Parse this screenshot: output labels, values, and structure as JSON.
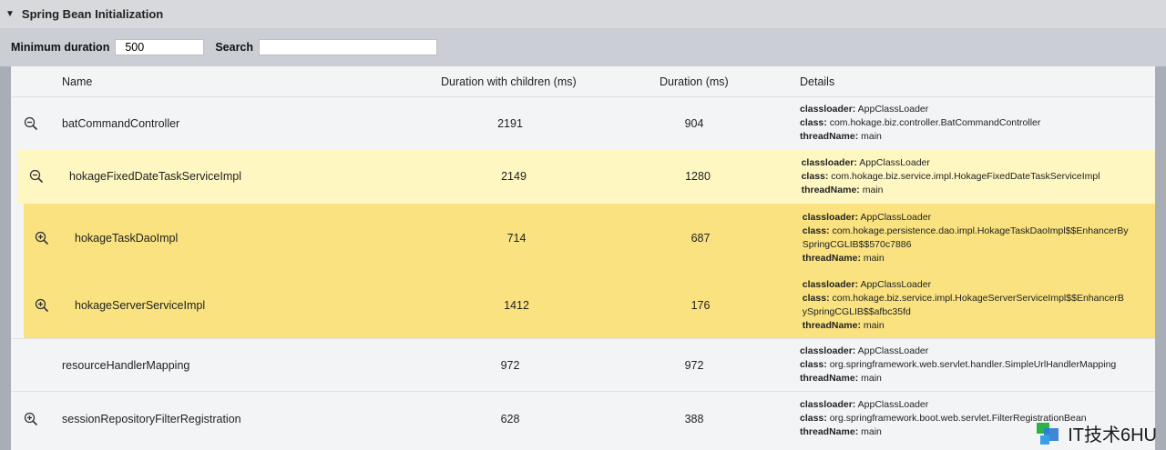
{
  "header": {
    "title": "Spring Bean Initialization"
  },
  "controls": {
    "min_label": "Minimum duration",
    "min_value": "500",
    "search_label": "Search",
    "search_value": ""
  },
  "table": {
    "columns": {
      "name": "Name",
      "dwc": "Duration with children (ms)",
      "dur": "Duration (ms)",
      "details": "Details"
    },
    "rows": [
      {
        "name": "batCommandController",
        "dwc": "2191",
        "dur": "904",
        "classloader": "AppClassLoader",
        "class_lines": [
          "com.hokage.biz.controller.BatCommandController"
        ],
        "threadName": "main",
        "icon": "zoom-out-icon"
      },
      {
        "name": "hokageFixedDateTaskServiceImpl",
        "dwc": "2149",
        "dur": "1280",
        "classloader": "AppClassLoader",
        "class_lines": [
          "com.hokage.biz.service.impl.HokageFixedDateTaskServiceImpl"
        ],
        "threadName": "main",
        "icon": "zoom-out-icon"
      },
      {
        "name": "hokageTaskDaoImpl",
        "dwc": "714",
        "dur": "687",
        "classloader": "AppClassLoader",
        "class_lines": [
          "com.hokage.persistence.dao.impl.HokageTaskDaoImpl$$EnhancerBy",
          "SpringCGLIB$$570c7886"
        ],
        "threadName": "main",
        "icon": "zoom-in-icon"
      },
      {
        "name": "hokageServerServiceImpl",
        "dwc": "1412",
        "dur": "176",
        "classloader": "AppClassLoader",
        "class_lines": [
          "com.hokage.biz.service.impl.HokageServerServiceImpl$$EnhancerB",
          "ySpringCGLIB$$afbc35fd"
        ],
        "threadName": "main",
        "icon": "zoom-in-icon"
      },
      {
        "name": "resourceHandlerMapping",
        "dwc": "972",
        "dur": "972",
        "classloader": "AppClassLoader",
        "class_lines": [
          "org.springframework.web.servlet.handler.SimpleUrlHandlerMapping"
        ],
        "threadName": "main",
        "icon": ""
      },
      {
        "name": "sessionRepositoryFilterRegistration",
        "dwc": "628",
        "dur": "388",
        "classloader": "AppClassLoader",
        "class_lines": [
          "org.springframework.boot.web.servlet.FilterRegistrationBean"
        ],
        "threadName": "main",
        "icon": "zoom-in-icon"
      }
    ],
    "labels": {
      "classloader": "classloader:",
      "class": "class:",
      "threadName": "threadName:"
    }
  },
  "watermark": {
    "text": "IT技术6HU"
  },
  "colors": {
    "highlight_light": "#fff7c2",
    "highlight_strong": "#f9e27f"
  }
}
